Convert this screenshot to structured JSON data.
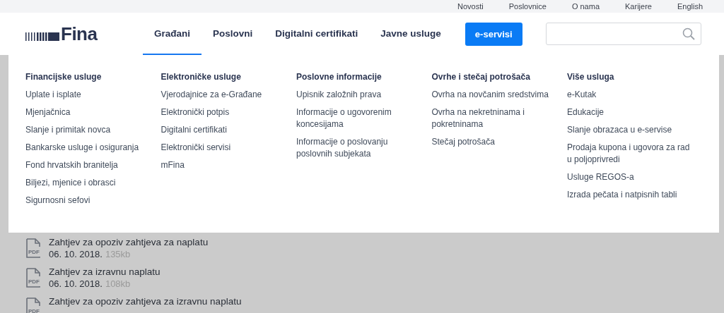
{
  "top_links": [
    "Novosti",
    "Poslovnice",
    "O nama",
    "Karijere",
    "English"
  ],
  "logo": {
    "text": "Fina"
  },
  "nav": [
    {
      "label": "Građani",
      "selected": true,
      "kind": "link"
    },
    {
      "label": "Poslovni",
      "selected": false,
      "kind": "link"
    },
    {
      "label": "Digitalni certifikati",
      "selected": false,
      "kind": "link"
    },
    {
      "label": "Javne usluge",
      "selected": false,
      "kind": "link"
    },
    {
      "label": "e-servisi",
      "selected": false,
      "kind": "button"
    }
  ],
  "menu_columns": [
    {
      "title": "Financijske usluge",
      "items": [
        "Uplate i isplate",
        "Mjenjačnica",
        "Slanje i primitak novca",
        "Bankarske usluge i osiguranja",
        "Fond hrvatskih branitelja",
        "Biljezi, mjenice i obrasci",
        "Sigurnosni sefovi"
      ]
    },
    {
      "title": "Elektroničke usluge",
      "items": [
        "Vjerodajnice za e-Građane",
        "Elektronički potpis",
        "Digitalni certifikati",
        "Elektronički servisi",
        "mFina"
      ]
    },
    {
      "title": "Poslovne informacije",
      "items": [
        "Upisnik založnih prava",
        "Informacije o ugovorenim koncesijama",
        "Informacije o poslovanju poslovnih subjekata"
      ]
    },
    {
      "title": "Ovrhe i stečaj potrošača",
      "items": [
        "Ovrha na novčanim sredstvima",
        "Ovrha na nekretninama i pokretninama",
        "Stečaj potrošača"
      ]
    },
    {
      "title": "Više usluga",
      "items": [
        "e-Kutak",
        "Edukacije",
        "Slanje obrazaca u e-servise",
        "Prodaja kupona i ugovora za rad u poljoprivredi",
        "Usluge REGOS-a",
        "Izrada pečata i natpisnih tabli"
      ]
    }
  ],
  "documents": [
    {
      "title": "Zahtjev za opoziv zahtjeva za naplatu",
      "icon_label": "PDF",
      "date": "06. 10. 2018.",
      "size": "135kb"
    },
    {
      "title": "Zahtjev za izravnu naplatu",
      "icon_label": "PDF",
      "date": "06. 10. 2018.",
      "size": "108kb"
    },
    {
      "title": "Zahtjev za opoziv zahtjeva za izravnu naplatu",
      "icon_label": "PDF"
    }
  ]
}
